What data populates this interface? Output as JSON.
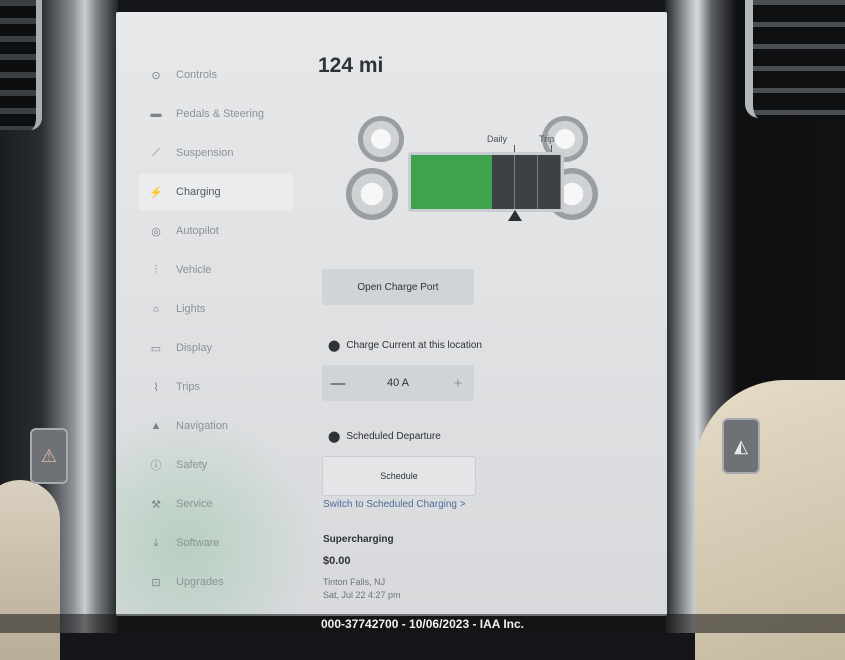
{
  "range": "124 mi",
  "sidebar": {
    "items": [
      {
        "label": "Controls",
        "icon": "toggle-icon",
        "glyph": "⊙",
        "active": false
      },
      {
        "label": "Pedals & Steering",
        "icon": "car-icon",
        "glyph": "▬",
        "active": false
      },
      {
        "label": "Suspension",
        "icon": "suspension-icon",
        "glyph": "⟋",
        "active": false
      },
      {
        "label": "Charging",
        "icon": "bolt-icon",
        "glyph": "⚡",
        "active": true
      },
      {
        "label": "Autopilot",
        "icon": "steering-wheel-icon",
        "glyph": "◎",
        "active": false
      },
      {
        "label": "Vehicle",
        "icon": "sliders-icon",
        "glyph": "⫶",
        "active": false
      },
      {
        "label": "Lights",
        "icon": "sun-icon",
        "glyph": "☼",
        "active": false
      },
      {
        "label": "Display",
        "icon": "display-icon",
        "glyph": "▭",
        "active": false
      },
      {
        "label": "Trips",
        "icon": "trips-icon",
        "glyph": "⌇",
        "active": false
      },
      {
        "label": "Navigation",
        "icon": "navigation-arrow-icon",
        "glyph": "▲",
        "active": false
      },
      {
        "label": "Safety",
        "icon": "safety-icon",
        "glyph": "ⓘ",
        "active": false
      },
      {
        "label": "Service",
        "icon": "wrench-icon",
        "glyph": "⚒",
        "active": false
      },
      {
        "label": "Software",
        "icon": "download-icon",
        "glyph": "⤓",
        "active": false
      },
      {
        "label": "Upgrades",
        "icon": "bag-icon",
        "glyph": "⊡",
        "active": false
      }
    ]
  },
  "battery": {
    "daily_label": "Daily",
    "trip_label": "Trip",
    "fill_fraction": 0.54
  },
  "open_charge_port": "Open Charge Port",
  "charge_current": {
    "label": "Charge Current at this location",
    "value": "40 A",
    "minus": "—",
    "plus": "+"
  },
  "scheduled_departure": {
    "label": "Scheduled Departure",
    "button": "Schedule",
    "link": "Switch to Scheduled Charging >"
  },
  "supercharging": {
    "title": "Supercharging",
    "cost": "$0.00",
    "location": "Tinton Falls, NJ",
    "date": "Sat, Jul 22 4:27 pm"
  },
  "watermark": "000-37742700 - 10/06/2023 - IAA Inc.",
  "colors": {
    "battery_green": "#3fa24e",
    "screen_bg": "#e2e4e6",
    "active_nav": "#eaecee"
  }
}
